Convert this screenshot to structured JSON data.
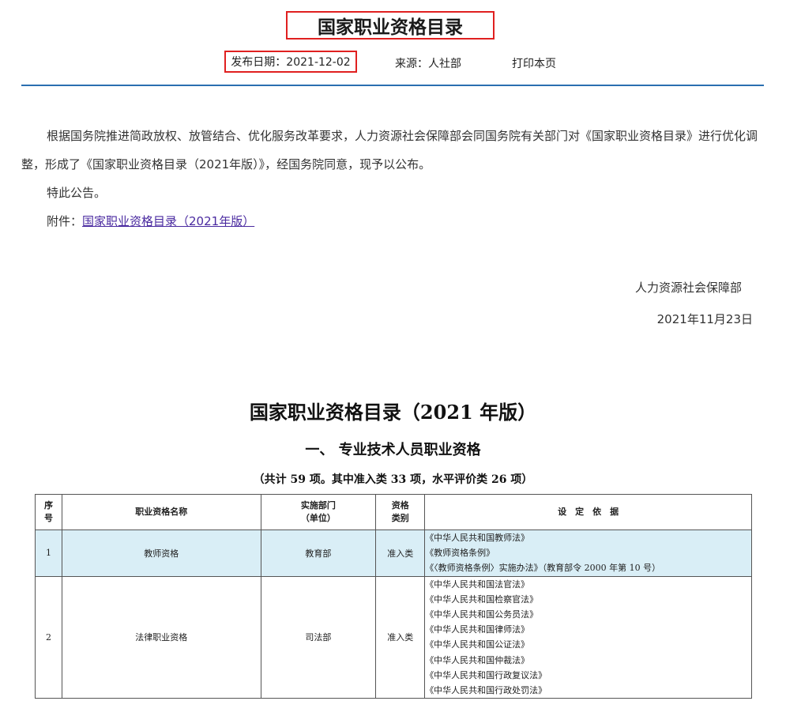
{
  "header": {
    "title": "国家职业资格目录",
    "publish_date": "发布日期：2021-12-02",
    "source": "来源：人社部",
    "print_label": "打印本页"
  },
  "notice": {
    "paragraph1": "根据国务院推进简政放权、放管结合、优化服务改革要求，人力资源社会保障部会同国务院有关部门对《国家职业资格目录》进行优化调整，形成了《国家职业资格目录（2021年版）》，经国务院同意，现予以公布。",
    "paragraph2": "特此公告。",
    "attachment_label": "附件：",
    "attachment_link": "国家职业资格目录（2021年版）",
    "signature": "人力资源社会保障部",
    "signature_date": "2021年11月23日"
  },
  "document": {
    "title": "国家职业资格目录（2021 年版）",
    "section": "一、  专业技术人员职业资格",
    "count": "（共计 59 项。其中准入类 33 项，水平评价类 26 项）"
  },
  "table": {
    "headers": {
      "seq_line1": "序",
      "seq_line2": "号",
      "name": "职业资格名称",
      "dept_line1": "实施部门",
      "dept_line2": "（单位）",
      "type_line1": "资格",
      "type_line2": "类别",
      "basis": "设　定　依　据"
    },
    "rows": [
      {
        "seq": "1",
        "name": "教师资格",
        "dept": "教育部",
        "type": "准入类",
        "basis": [
          "《中华人民共和国教师法》",
          "《教师资格条例》",
          "《〈教师资格条例〉实施办法》（教育部令 2000 年第 10 号）"
        ]
      },
      {
        "seq": "2",
        "name": "法律职业资格",
        "dept": "司法部",
        "type": "准入类",
        "basis": [
          "《中华人民共和国法官法》",
          "《中华人民共和国检察官法》",
          "《中华人民共和国公务员法》",
          "《中华人民共和国律师法》",
          "《中华人民共和国公证法》",
          "《中华人民共和国仲裁法》",
          "《中华人民共和国行政复议法》",
          "《中华人民共和国行政处罚法》"
        ]
      }
    ]
  },
  "colors": {
    "highlight_border": "#e02020",
    "rule": "#2a6fb0",
    "link": "#4a2aa0",
    "row_highlight": "#d9eef6"
  }
}
